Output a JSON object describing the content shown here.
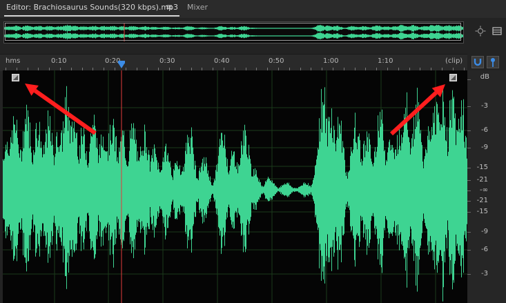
{
  "tabs": {
    "editor_label": "Editor: Brachiosaurus Sounds(320  kbps).mp3",
    "editor_menu_icon": "menu-icon",
    "mixer_label": "Mixer"
  },
  "toolbar_icons": [
    "zoom-navigator-icon",
    "panel-menu-icon",
    "snap-magnet-icon",
    "marker-pin-icon"
  ],
  "ruler": {
    "format_label": "hms",
    "end_label": "(clip)",
    "times": [
      "0:10",
      "0:20",
      "0:30",
      "0:40",
      "0:50",
      "1:00",
      "1:10"
    ]
  },
  "db_scale": {
    "unit": "dB",
    "labels": [
      "-3",
      "-6",
      "-9",
      "-15",
      "-21",
      "-∞",
      "-21",
      "-15",
      "-9",
      "-6",
      "-3"
    ]
  },
  "colors": {
    "waveform": "#3ed492",
    "playhead": "#e23a3a",
    "annotation_arrow": "#ff1e1e",
    "accent": "#3c8ce6"
  }
}
